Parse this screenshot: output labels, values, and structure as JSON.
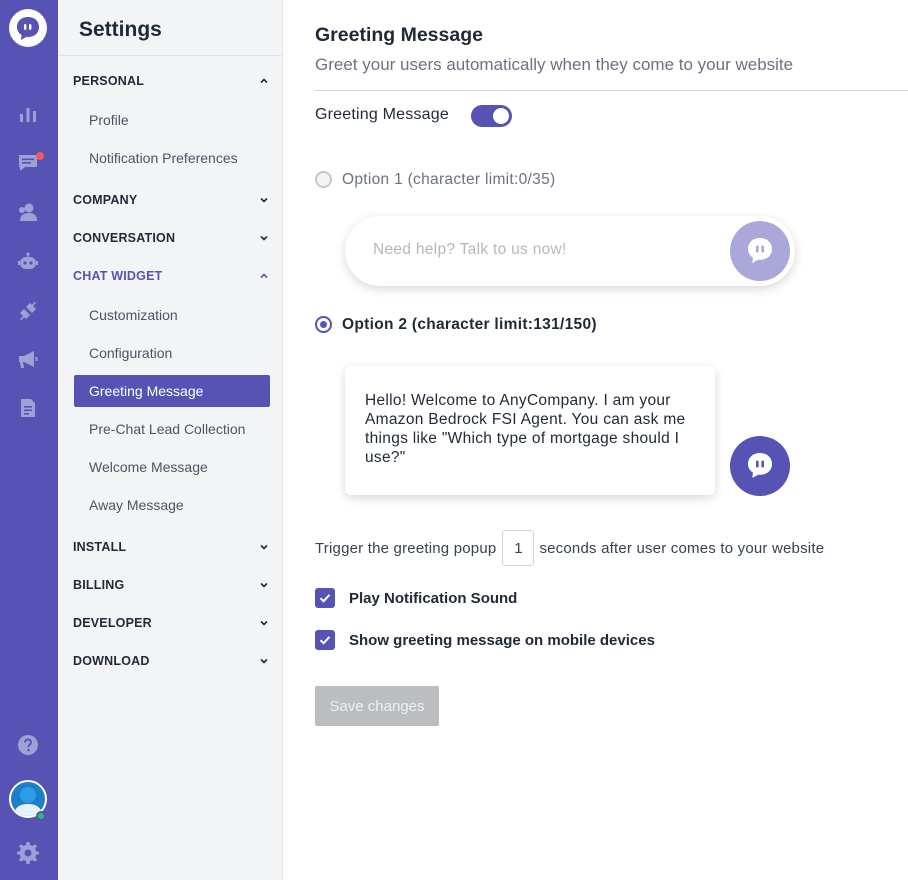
{
  "colors": {
    "brand": "#5653b4",
    "brand_light": "#aaa8d9",
    "notification": "#f05a5a",
    "online": "#22c55e"
  },
  "rail": {
    "items": [
      {
        "icon": "reports-icon"
      },
      {
        "icon": "conversations-icon",
        "has_notification": true
      },
      {
        "icon": "contacts-icon"
      },
      {
        "icon": "bot-icon"
      },
      {
        "icon": "integrations-icon"
      },
      {
        "icon": "campaigns-icon"
      },
      {
        "icon": "knowledge-base-icon"
      }
    ],
    "bottom": [
      {
        "icon": "help-icon"
      },
      {
        "icon": "user-avatar"
      },
      {
        "icon": "settings-gear-icon"
      }
    ]
  },
  "sidebar": {
    "title": "Settings",
    "sections": [
      {
        "label": "PERSONAL",
        "expanded": true,
        "items": [
          "Profile",
          "Notification Preferences"
        ]
      },
      {
        "label": "COMPANY",
        "expanded": false
      },
      {
        "label": "CONVERSATION",
        "expanded": false
      },
      {
        "label": "CHAT WIDGET",
        "expanded": true,
        "active": true,
        "items": [
          "Customization",
          "Configuration",
          "Greeting Message",
          "Pre-Chat Lead Collection",
          "Welcome Message",
          "Away Message"
        ],
        "selected": "Greeting Message"
      },
      {
        "label": "INSTALL",
        "expanded": false
      },
      {
        "label": "BILLING",
        "expanded": false
      },
      {
        "label": "DEVELOPER",
        "expanded": false
      },
      {
        "label": "DOWNLOAD",
        "expanded": false
      }
    ]
  },
  "main": {
    "title": "Greeting Message",
    "subtitle": "Greet your users automatically when they come to your website",
    "toggle_label": "Greeting Message",
    "toggle_on": true,
    "option1": {
      "label": "Option 1 (character limit:0/35)",
      "placeholder": "Need help? Talk to us now!",
      "selected": false
    },
    "option2": {
      "label": "Option 2 (character limit:131/150)",
      "message": "Hello! Welcome to AnyCompany. I am your Amazon Bedrock FSI Agent. You can ask me things like \"Which type of mortgage should I use?\"",
      "selected": true
    },
    "trigger": {
      "prefix": "Trigger the greeting popup",
      "value": "1",
      "suffix": "seconds after user comes to your website"
    },
    "checkboxes": [
      {
        "label": "Play Notification Sound",
        "checked": true
      },
      {
        "label": "Show greeting message on mobile devices",
        "checked": true
      }
    ],
    "save_label": "Save changes"
  }
}
